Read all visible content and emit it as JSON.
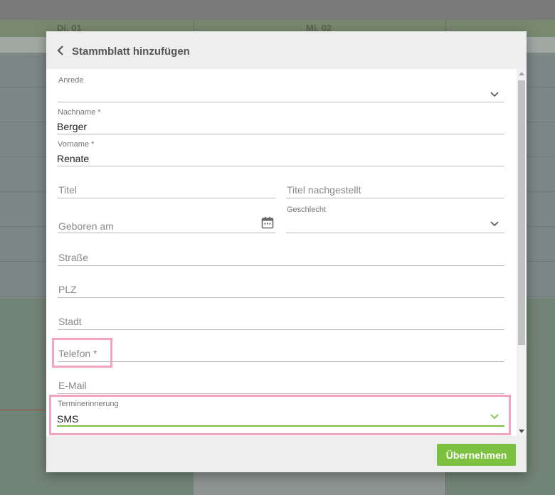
{
  "background": {
    "days": [
      "Di. 01",
      "Mi. 02"
    ]
  },
  "dialog": {
    "title": "Stammblatt hinzufügen",
    "submit_label": "Übernehmen",
    "fields": {
      "anrede": {
        "label": "Anrede",
        "value": ""
      },
      "nachname": {
        "label": "Nachname *",
        "value": "Berger"
      },
      "vorname": {
        "label": "Vorname *",
        "value": "Renate"
      },
      "titel": {
        "placeholder": "Titel"
      },
      "titel_nachgestellt": {
        "placeholder": "Titel nachgestellt"
      },
      "geboren_am": {
        "placeholder": "Geboren am"
      },
      "geschlecht": {
        "label": "Geschlecht",
        "value": ""
      },
      "strasse": {
        "placeholder": "Straße"
      },
      "plz": {
        "placeholder": "PLZ"
      },
      "stadt": {
        "placeholder": "Stadt"
      },
      "telefon": {
        "placeholder": "Telefon *"
      },
      "email": {
        "placeholder": "E-Mail"
      },
      "terminerinnerung": {
        "label": "Terminerinnerung",
        "value": "SMS"
      }
    }
  },
  "colors": {
    "accent_green": "#7cc13f",
    "highlight_pink": "#f4a3c2"
  },
  "icons": [
    "chevron-left-icon",
    "chevron-down-icon",
    "calendar-icon"
  ]
}
